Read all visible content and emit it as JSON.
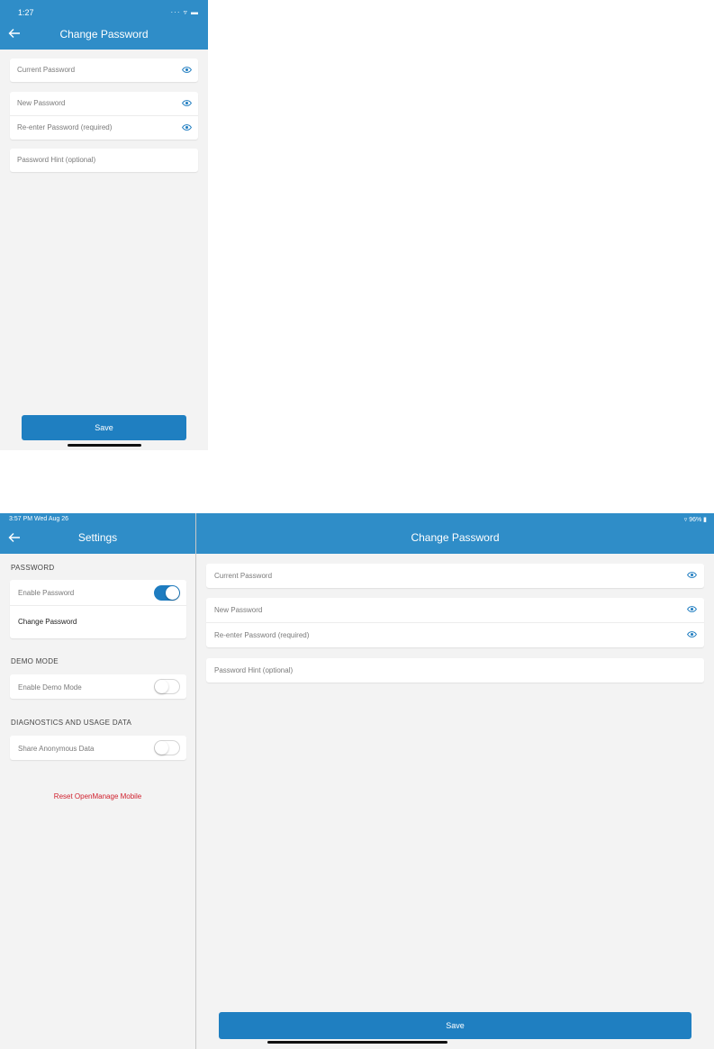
{
  "phone": {
    "status": {
      "time": "1:27",
      "icons": "··· ▿ ▬"
    },
    "header": {
      "title": "Change Password",
      "back_icon": "back-arrow-icon"
    },
    "fields": {
      "current_password": "Current Password",
      "new_password": "New Password",
      "reenter_password": "Re-enter Password (required)",
      "password_hint": "Password Hint (optional)"
    },
    "save_label": "Save"
  },
  "tablet": {
    "status": {
      "left": "3:57 PM  Wed Aug 26",
      "right": "▿ 96% ▮"
    },
    "left_pane": {
      "title": "Settings",
      "sections": {
        "password": "PASSWORD",
        "demo_mode": "DEMO MODE",
        "diagnostics": "DIAGNOSTICS AND USAGE DATA"
      },
      "enable_password": {
        "label": "Enable Password",
        "on": true
      },
      "change_password": "Change Password",
      "enable_demo_mode": {
        "label": "Enable Demo Mode",
        "on": false
      },
      "share_anonymous_data": {
        "label": "Share Anonymous Data",
        "on": false
      },
      "reset_label": "Reset OpenManage Mobile"
    },
    "right_pane": {
      "title": "Change Password",
      "fields": {
        "current_password": "Current Password",
        "new_password": "New Password",
        "reenter_password": "Re-enter Password (required)",
        "password_hint": "Password Hint (optional)"
      },
      "save_label": "Save"
    }
  },
  "colors": {
    "header_blue": "#2f8dc8",
    "button_blue": "#1f7fc1",
    "eye_blue": "#1e7cc0",
    "reset_red": "#d0212e",
    "background": "#f3f3f3"
  }
}
